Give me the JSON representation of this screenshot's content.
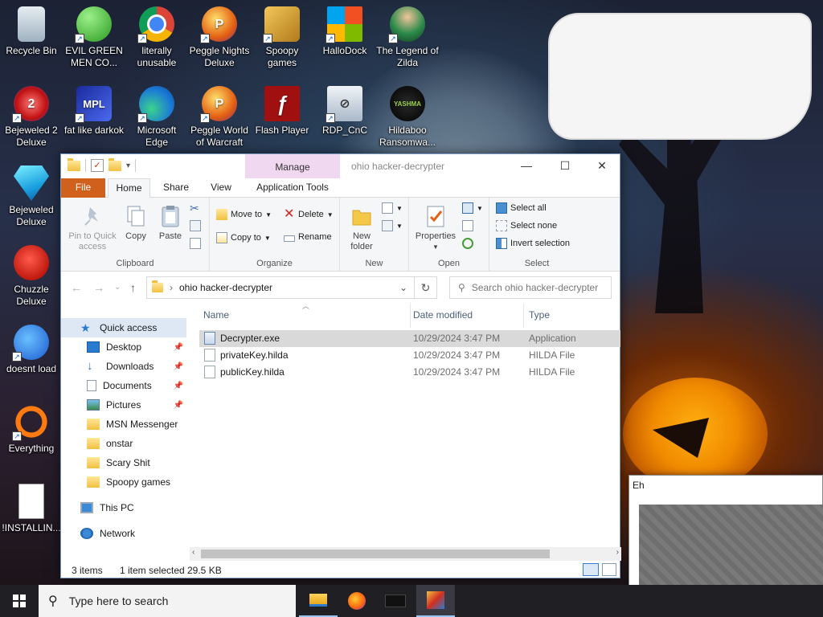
{
  "desktop": {
    "icons": [
      {
        "label": "Recycle Bin",
        "icon": "recycle-bin-icon"
      },
      {
        "label": "EVIL GREEN MEN CO...",
        "icon": "green-men-icon"
      },
      {
        "label": "literally unusable",
        "icon": "chrome-icon"
      },
      {
        "label": "Peggle Nights Deluxe",
        "icon": "peggle-nights-icon"
      },
      {
        "label": "Spoopy games",
        "icon": "spoopy-games-icon"
      },
      {
        "label": "HalloDock",
        "icon": "windows-shield-icon"
      },
      {
        "label": "The Legend of Zilda",
        "icon": "zilda-icon"
      },
      {
        "label": "Bejeweled 2 Deluxe",
        "icon": "bejeweled-2-icon"
      },
      {
        "label": "fat like darkok",
        "icon": "mpl-icon"
      },
      {
        "label": "Microsoft Edge",
        "icon": "edge-icon"
      },
      {
        "label": "Peggle World of Warcraft",
        "icon": "peggle-wow-icon"
      },
      {
        "label": "Flash Player",
        "icon": "flash-icon"
      },
      {
        "label": "RDP_CnC",
        "icon": "rdp-icon"
      },
      {
        "label": "Hildaboo Ransomwa...",
        "icon": "hildaboo-icon"
      },
      {
        "label": "Bejeweled Deluxe",
        "icon": "bejeweled-icon"
      },
      {
        "label": "Chuzzle Deluxe",
        "icon": "chuzzle-icon"
      },
      {
        "label": "doesnt load",
        "icon": "thunderbird-icon"
      },
      {
        "label": "Everything",
        "icon": "everything-icon"
      },
      {
        "label": "!INSTALLIN...",
        "icon": "document-icon"
      }
    ],
    "icon_glyphs": {
      "rdp": "⊘",
      "hildaboo": "YASHMA",
      "flash": "ƒ",
      "mpl": "MPL"
    }
  },
  "explorer": {
    "title": "ohio hacker-decrypter",
    "manage_tab": "Manage",
    "tabs": {
      "file": "File",
      "home": "Home",
      "share": "Share",
      "view": "View",
      "app_tools": "Application Tools"
    },
    "help": "?",
    "ribbon": {
      "clipboard": {
        "label": "Clipboard",
        "pin": "Pin to Quick access",
        "copy": "Copy",
        "paste": "Paste"
      },
      "organize": {
        "label": "Organize",
        "move_to": "Move to",
        "copy_to": "Copy to",
        "delete": "Delete",
        "rename": "Rename"
      },
      "new": {
        "label": "New",
        "new_folder": "New folder"
      },
      "open": {
        "label": "Open",
        "properties": "Properties"
      },
      "select": {
        "label": "Select",
        "select_all": "Select all",
        "select_none": "Select none",
        "invert": "Invert selection"
      }
    },
    "address": {
      "path": "ohio hacker-decrypter",
      "search_placeholder": "Search ohio hacker-decrypter"
    },
    "nav": {
      "quick_access": "Quick access",
      "items": [
        {
          "label": "Desktop",
          "pinned": true,
          "icon": "desktop-icon"
        },
        {
          "label": "Downloads",
          "pinned": true,
          "icon": "downloads-icon"
        },
        {
          "label": "Documents",
          "pinned": true,
          "icon": "documents-icon"
        },
        {
          "label": "Pictures",
          "pinned": true,
          "icon": "pictures-icon"
        },
        {
          "label": "MSN Messenger",
          "pinned": false,
          "icon": "folder-icon"
        },
        {
          "label": "onstar",
          "pinned": false,
          "icon": "folder-icon"
        },
        {
          "label": "Scary Shit",
          "pinned": false,
          "icon": "folder-icon"
        },
        {
          "label": "Spoopy games",
          "pinned": false,
          "icon": "folder-icon"
        }
      ],
      "this_pc": "This PC",
      "network": "Network"
    },
    "columns": {
      "name": "Name",
      "date": "Date modified",
      "type": "Type"
    },
    "files": [
      {
        "name": "Decrypter.exe",
        "date": "10/29/2024 3:47 PM",
        "type": "Application",
        "selected": true
      },
      {
        "name": "privateKey.hilda",
        "date": "10/29/2024 3:47 PM",
        "type": "HILDA File",
        "selected": false
      },
      {
        "name": "publicKey.hilda",
        "date": "10/29/2024 3:47 PM",
        "type": "HILDA File",
        "selected": false
      }
    ],
    "status": {
      "count": "3 items",
      "selection": "1 item selected",
      "size": "29.5 KB"
    }
  },
  "eh_window": {
    "title": "Eh"
  },
  "taskbar": {
    "search_placeholder": "Type here to search"
  },
  "colors": {
    "accent": "#d0611c",
    "manage": "#f0d8f0",
    "selection": "#d9d9d9",
    "taskbar": "#1f1f24"
  }
}
